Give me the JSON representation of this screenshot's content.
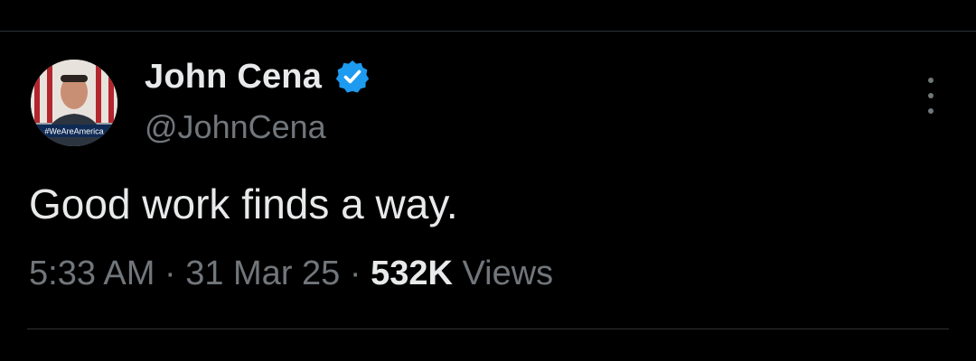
{
  "tweet": {
    "author": {
      "display_name": "John Cena",
      "handle": "@JohnCena",
      "verified": true,
      "avatar_banner_text": "#WeAreAmerica"
    },
    "text": "Good work finds a way.",
    "meta": {
      "time": "5:33 AM",
      "separator": " · ",
      "date": "31 Mar 25",
      "views_count": "532K",
      "views_label": "Views"
    },
    "more_icon": "more-vertical-icon"
  },
  "colors": {
    "background": "#000000",
    "text_primary": "#e7e9ea",
    "text_secondary": "#71767b",
    "verified_blue": "#1d9bf0",
    "divider": "#2f3336"
  }
}
